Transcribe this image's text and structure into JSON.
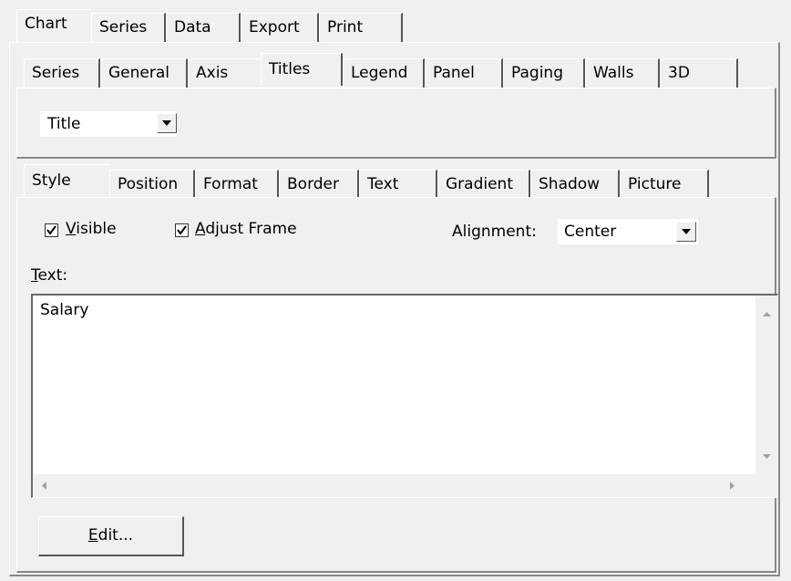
{
  "tabs_top": [
    {
      "label": "Chart"
    },
    {
      "label": "Series"
    },
    {
      "label": "Data"
    },
    {
      "label": "Export"
    },
    {
      "label": "Print"
    }
  ],
  "tabs_second": [
    {
      "label": "Series"
    },
    {
      "label": "General"
    },
    {
      "label": "Axis"
    },
    {
      "label": "Titles"
    },
    {
      "label": "Legend"
    },
    {
      "label": "Panel"
    },
    {
      "label": "Paging"
    },
    {
      "label": "Walls"
    },
    {
      "label": "3D"
    }
  ],
  "title_selector": {
    "value": "Title"
  },
  "tabs_third": [
    {
      "label": "Style"
    },
    {
      "label": "Position"
    },
    {
      "label": "Format"
    },
    {
      "label": "Border"
    },
    {
      "label": "Text"
    },
    {
      "label": "Gradient"
    },
    {
      "label": "Shadow"
    },
    {
      "label": "Picture"
    }
  ],
  "style": {
    "visible_label_u": "V",
    "visible_label_rest": "isible",
    "visible_checked": true,
    "adjust_label_u": "A",
    "adjust_label_rest": "djust Frame",
    "adjust_checked": true,
    "alignment_label_pre": "Ali",
    "alignment_label_u": "g",
    "alignment_label_rest": "nment:",
    "alignment_value": "Center",
    "text_label_u": "T",
    "text_label_rest": "ext:",
    "text_value": "Salary",
    "edit_button_u": "E",
    "edit_button_rest": "dit..."
  }
}
